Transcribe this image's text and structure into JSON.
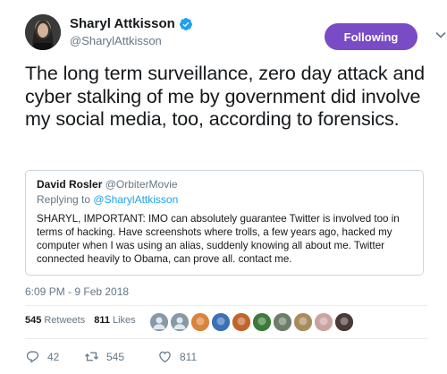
{
  "author": {
    "display_name": "Sharyl Attkisson",
    "handle": "@SharylAttkisson",
    "verified": true
  },
  "follow_button": {
    "label": "Following",
    "color": "#794bc4"
  },
  "tweet": {
    "text": "The long term surveillance, zero day attack and cyber stalking of me by government did involve my social media, too, according to forensics.",
    "timestamp": "6:09 PM - 9 Feb 2018"
  },
  "quoted_tweet": {
    "display_name": "David Rosler",
    "handle": "@OrbiterMovie",
    "replying_prefix": "Replying to",
    "replying_handle": "@SharylAttkisson",
    "text": "SHARYL, IMPORTANT: IMO can absolutely guarantee Twitter is involved too in terms of hacking. Have screenshots where trolls, a few years ago, hacked my computer when I was using an alias, suddenly knowing all about me. Twitter connected heavily to Obama, can prove all. contact me."
  },
  "stats": {
    "retweets_count": "545",
    "retweets_label": "Retweets",
    "likes_count": "811",
    "likes_label": "Likes"
  },
  "liker_avatars": [
    {
      "icon": "default-avatar-icon",
      "color": "#8899a6"
    },
    {
      "icon": "default-avatar-icon",
      "color": "#8899a6"
    },
    {
      "icon": "avatar-orange",
      "color": "#d9833b"
    },
    {
      "icon": "avatar-flag",
      "color": "#3a70b5"
    },
    {
      "icon": "avatar-orange-dark",
      "color": "#c0642b"
    },
    {
      "icon": "avatar-green",
      "color": "#3c7a3a"
    },
    {
      "icon": "avatar-grey-green",
      "color": "#6e7d6a"
    },
    {
      "icon": "avatar-tan",
      "color": "#a88c5e"
    },
    {
      "icon": "avatar-pink",
      "color": "#c9a3a0"
    },
    {
      "icon": "avatar-dark",
      "color": "#4a3a36"
    }
  ],
  "actions": {
    "reply_count": "42",
    "retweet_count": "545",
    "like_count": "811"
  },
  "colors": {
    "link": "#1da1f2",
    "verified": "#1da1f2",
    "muted": "#657786"
  }
}
